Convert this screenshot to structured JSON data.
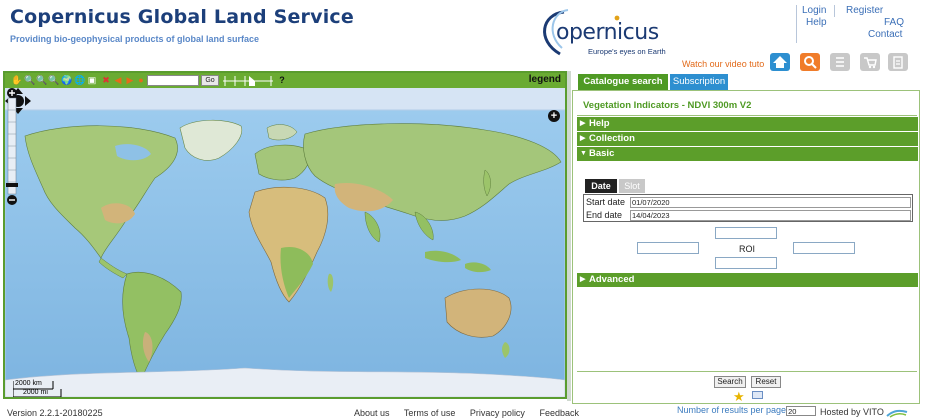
{
  "header": {
    "title": "Copernicus Global Land Service",
    "subtitle": "Providing bio-geophysical products of global land surface",
    "logo_word": "opernicus",
    "logo_tagline": "Europe's eyes on Earth",
    "links": {
      "login": "Login",
      "register": "Register",
      "help": "Help",
      "faq": "FAQ",
      "contact": "Contact"
    },
    "video_link": "Watch our video tuto",
    "tool_buttons": [
      "home-icon",
      "search-icon",
      "list-icon",
      "cart-icon",
      "clipboard-icon"
    ]
  },
  "map": {
    "toolbar": {
      "go_label": "Go",
      "help_label": "?",
      "legend_label": "legend",
      "search_value": ""
    },
    "scale": {
      "km": "2000 km",
      "mi": "2000 mi"
    },
    "colors": {
      "panel_green": "#5a9c2e",
      "ocean": "#8ec1e6",
      "land": "#9cc46a"
    }
  },
  "panel": {
    "tabs": {
      "catalogue": "Catalogue search",
      "subscription": "Subscription"
    },
    "product_title": "Vegetation Indicators - NDVI 300m V2",
    "sections": {
      "help": "Help",
      "collection": "Collection",
      "basic": "Basic",
      "advanced": "Advanced"
    },
    "subtabs": {
      "date": "Date",
      "slot": "Slot"
    },
    "start_label": "Start date",
    "start_value": "01/07/2020",
    "end_label": "End date",
    "end_value": "14/04/2023",
    "roi_label": "ROI",
    "search_button": "Search",
    "reset_button": "Reset",
    "results_label": "Number of results per page",
    "results_value": "20"
  },
  "footer": {
    "version": "Version 2.2.1-20180225",
    "about": "About us",
    "terms": "Terms of use",
    "privacy": "Privacy policy",
    "feedback": "Feedback",
    "hosted": "Hosted by VITO"
  }
}
